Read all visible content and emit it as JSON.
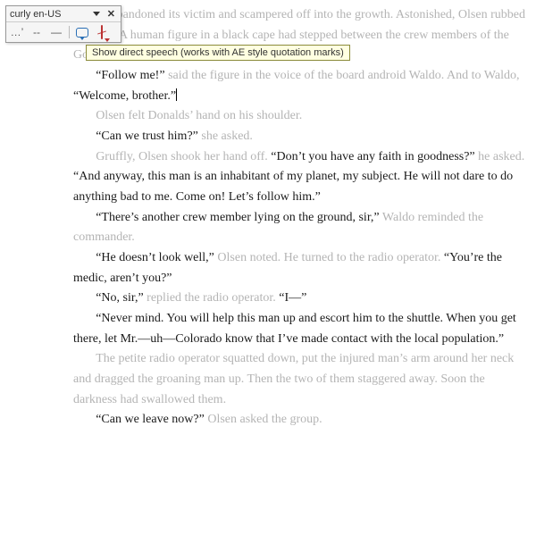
{
  "toolbar": {
    "title": "curly en-US",
    "btn_quote": "…’",
    "btn_dash": "--",
    "btn_minus": "—",
    "tooltip": "Show direct speech (works with AE style quotation marks)"
  },
  "text": {
    "p1a": "reature abandoned its victim and scampered off into the ",
    "p1b": "growth. Astonished, Olsen rubbed his eyes. A human figure in a black cape had stepped between the crew members of the Governant Hive. His ",
    "p2q1": "“Follow me!”",
    "p2a": " said the figure in the voice of the board android Waldo. And to Waldo, ",
    "p2q2": "“Welcome, brother.”",
    "p3": "Olsen felt Donalds’ hand on his shoulder.",
    "p4q": "“Can we trust him?”",
    "p4a": " she asked.",
    "p5a": "Gruffly, Olsen shook her hand off. ",
    "p5q1": "“Don’t you have any faith in goodness?”",
    "p5b": " he asked. ",
    "p5q2": "“And anyway, this man is an inhabitant of my planet, my subject. He will not dare to do anything bad to me. Come on! Let’s follow him.”",
    "p6q": "“There’s another crew member lying on the ground, sir,”",
    "p6a": " Waldo reminded the commander.",
    "p7q1": "“He doesn’t look well,”",
    "p7a": " Olsen noted. He turned to the radio operator. ",
    "p7q2": "“You’re the medic, aren’t you?”",
    "p8q1": "“No, sir,”",
    "p8a": " replied the radio operator. ",
    "p8q2": "“I—”",
    "p9q": "“Never mind. You will help this man up and escort him to the shuttle. When you get there, let Mr.—uh—Colorado know that I’ve made contact with the local population.”",
    "p10": "The petite radio operator squatted down, put the injured man’s arm around her neck and dragged the groaning man up. Then the two of them staggered away. Soon the darkness had swallowed them.",
    "p11q": "“Can we leave now?”",
    "p11a": " Olsen asked the group."
  }
}
